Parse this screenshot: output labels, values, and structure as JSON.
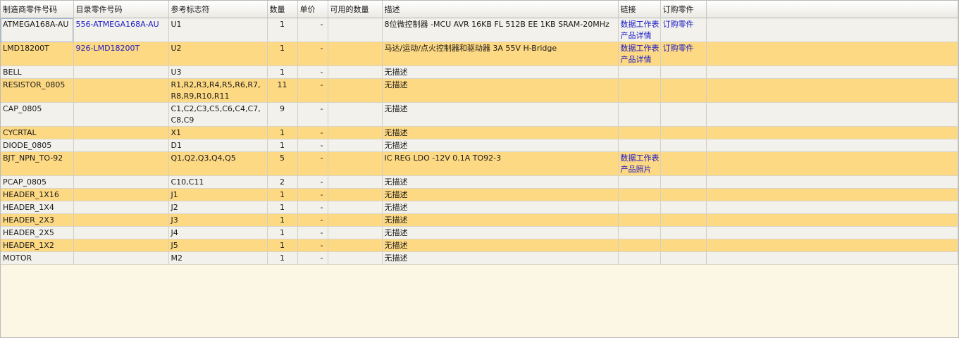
{
  "columns": [
    "制造商零件号码",
    "目录零件号码",
    "参考标志符",
    "数量",
    "单价",
    "可用的数量",
    "描述",
    "链接",
    "订购零件"
  ],
  "rows": [
    {
      "mfr": "ATMEGA168A-AU",
      "cat": "556-ATMEGA168A-AU",
      "ref": "U1",
      "qty": "1",
      "price": "-",
      "avail": "",
      "desc": "8位微控制器 -MCU AVR 16KB FL 512B EE 1KB SRAM-20MHz",
      "links": [
        "数据工作表",
        "产品详情"
      ],
      "order": "订购零件"
    },
    {
      "mfr": "LMD18200T",
      "cat": "926-LMD18200T",
      "ref": "U2",
      "qty": "1",
      "price": "-",
      "avail": "",
      "desc": "马达/运动/点火控制器和驱动器 3A 55V H-Bridge",
      "links": [
        "数据工作表",
        "产品详情"
      ],
      "order": "订购零件"
    },
    {
      "mfr": "BELL",
      "cat": "",
      "ref": "U3",
      "qty": "1",
      "price": "-",
      "avail": "",
      "desc": "无描述",
      "links": [],
      "order": ""
    },
    {
      "mfr": "RESISTOR_0805",
      "cat": "",
      "ref": "R1,R2,R3,R4,R5,R6,R7,R8,R9,R10,R11",
      "qty": "11",
      "price": "-",
      "avail": "",
      "desc": "无描述",
      "links": [],
      "order": ""
    },
    {
      "mfr": "CAP_0805",
      "cat": "",
      "ref": "C1,C2,C3,C5,C6,C4,C7,C8,C9",
      "qty": "9",
      "price": "-",
      "avail": "",
      "desc": "无描述",
      "links": [],
      "order": ""
    },
    {
      "mfr": "CYCRTAL",
      "cat": "",
      "ref": "X1",
      "qty": "1",
      "price": "-",
      "avail": "",
      "desc": "无描述",
      "links": [],
      "order": ""
    },
    {
      "mfr": "DIODE_0805",
      "cat": "",
      "ref": "D1",
      "qty": "1",
      "price": "-",
      "avail": "",
      "desc": "无描述",
      "links": [],
      "order": ""
    },
    {
      "mfr": "BJT_NPN_TO-92",
      "cat": "",
      "ref": "Q1,Q2,Q3,Q4,Q5",
      "qty": "5",
      "price": "-",
      "avail": "",
      "desc": "IC REG LDO -12V 0.1A TO92-3",
      "links": [
        "数据工作表",
        "产品照片"
      ],
      "order": ""
    },
    {
      "mfr": "PCAP_0805",
      "cat": "",
      "ref": "C10,C11",
      "qty": "2",
      "price": "-",
      "avail": "",
      "desc": "无描述",
      "links": [],
      "order": ""
    },
    {
      "mfr": "HEADER_1X16",
      "cat": "",
      "ref": "J1",
      "qty": "1",
      "price": "-",
      "avail": "",
      "desc": "无描述",
      "links": [],
      "order": ""
    },
    {
      "mfr": "HEADER_1X4",
      "cat": "",
      "ref": "J2",
      "qty": "1",
      "price": "-",
      "avail": "",
      "desc": "无描述",
      "links": [],
      "order": ""
    },
    {
      "mfr": "HEADER_2X3",
      "cat": "",
      "ref": "J3",
      "qty": "1",
      "price": "-",
      "avail": "",
      "desc": "无描述",
      "links": [],
      "order": ""
    },
    {
      "mfr": "HEADER_2X5",
      "cat": "",
      "ref": "J4",
      "qty": "1",
      "price": "-",
      "avail": "",
      "desc": "无描述",
      "links": [],
      "order": ""
    },
    {
      "mfr": "HEADER_1X2",
      "cat": "",
      "ref": "J5",
      "qty": "1",
      "price": "-",
      "avail": "",
      "desc": "无描述",
      "links": [],
      "order": ""
    },
    {
      "mfr": "MOTOR",
      "cat": "",
      "ref": "M2",
      "qty": "1",
      "price": "-",
      "avail": "",
      "desc": "无描述",
      "links": [],
      "order": ""
    }
  ],
  "colors": {
    "odd_row": "#f2f1ec",
    "even_row": "#fed983",
    "link": "#1a1ac8",
    "background": "#fcf6e4"
  }
}
